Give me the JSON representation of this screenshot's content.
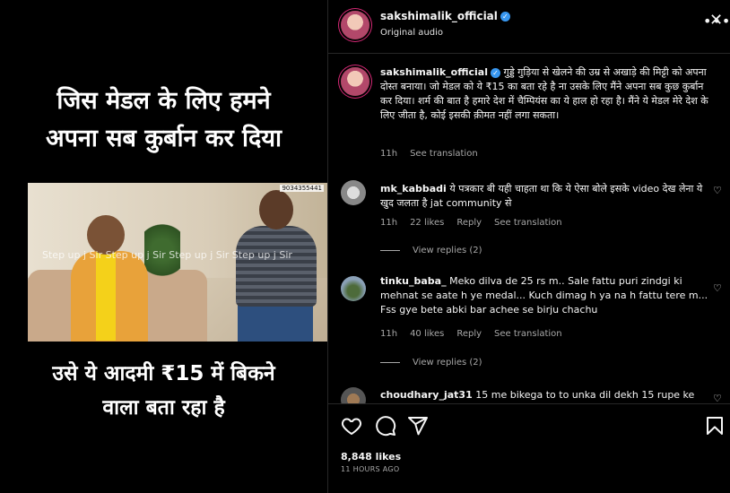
{
  "media": {
    "caption_top_line1": "जिस मेडल के लिए हमने",
    "caption_top_line2": "अपना सब कुर्बान कर दिया",
    "video_watermark": "Step up j Sir Step up j Sir Step up j Sir Step up j Sir",
    "video_phone_fragment": "9034355441",
    "caption_bottom_line1": "उसे ये आदमी ₹15 में बिकने",
    "caption_bottom_line2": "वाला बता रहा है"
  },
  "header": {
    "username": "sakshimalik_official",
    "audio": "Original audio",
    "more_icon": "more-horizontal-icon",
    "close_icon": "close-icon"
  },
  "caption": {
    "username": "sakshimalik_official",
    "text": "गुड्डे गुड़िया से खेलने की उम्र से अखाड़े की मिट्टी को अपना दोस्त बनाया। जो मेडल को ये ₹15 का बता रहे है ना उसके लिए मैंने अपना सब कुछ कुर्बान कर दिया। शर्म की बात है हमारे देश में चैम्पियंस का ये हाल हो रहा है। मैंने ये मेडल मेरे देश के लिए जीता है, कोई इसकी क़ीमत नहीं लगा सकता।",
    "time": "11h",
    "see_translation": "See translation"
  },
  "comments": [
    {
      "username": "mk_kabbadi",
      "text": "ये पत्रकार बी यही चाहता था कि ये ऐसा बोले इसके video देख लेना ये खुद जलता है jat community से",
      "time": "11h",
      "likes": "22 likes",
      "reply": "Reply",
      "see_translation": "See translation",
      "view_replies": "View replies (2)"
    },
    {
      "username": "tinku_baba_",
      "text": "Meko dilva de 25 rs m.. Sale fattu puri zindgi ki mehnat se aate h ye medal... Kuch dimag h ya na h fattu tere m... Fss gye bete abki bar achee se birju chachu",
      "time": "11h",
      "likes": "40 likes",
      "reply": "Reply",
      "see_translation": "See translation",
      "view_replies": "View replies (2)"
    },
    {
      "username": "choudhary_jat31",
      "text": "15 me bikega to to unka dil dekh 15 rupe ke"
    }
  ],
  "actions": {
    "like_icon": "heart-outline-icon",
    "comment_icon": "comment-icon",
    "share_icon": "paper-plane-icon",
    "save_icon": "bookmark-icon",
    "likes": "8,848 likes",
    "time": "11 HOURS AGO"
  },
  "colors": {
    "background": "#000000",
    "text": "#f5f5f5",
    "muted": "#a8a8a8",
    "verified": "#3897f0",
    "divider": "#262626"
  }
}
